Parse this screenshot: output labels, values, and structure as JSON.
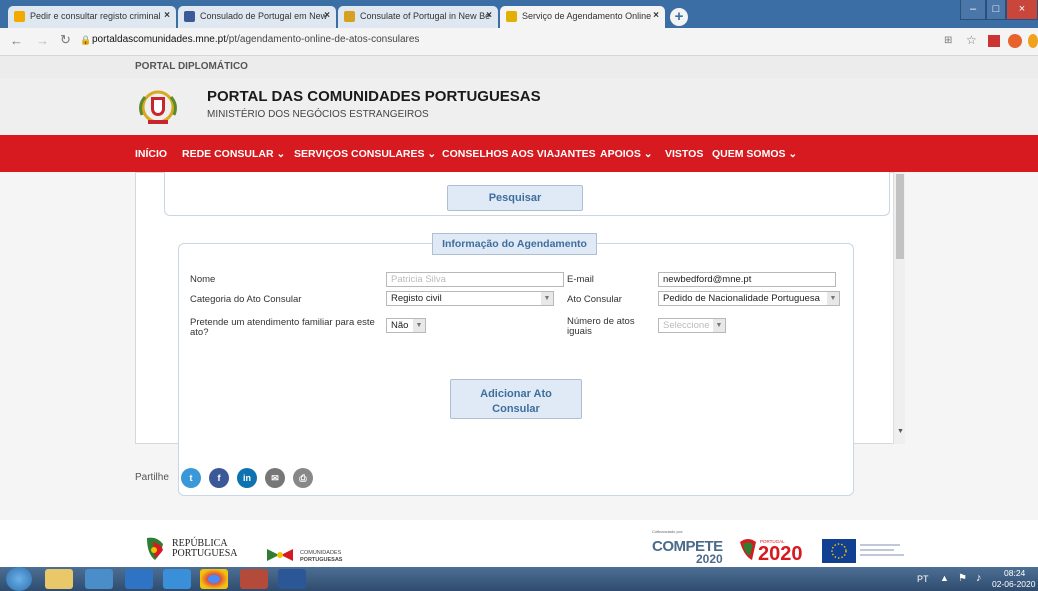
{
  "browser": {
    "tabs": [
      {
        "title": "Pedir e consultar registo criminal"
      },
      {
        "title": "Consulado de Portugal em New"
      },
      {
        "title": "Consulate of Portugal in New Be"
      },
      {
        "title": "Serviço de Agendamento Online"
      }
    ],
    "url_host": "portaldascomunidades.mne.pt",
    "url_path": "/pt/agendamento-online-de-atos-consulares"
  },
  "site": {
    "top_label": "PORTAL DIPLOMÁTICO",
    "title": "PORTAL DAS COMUNIDADES PORTUGUESAS",
    "subtitle": "MINISTÉRIO DOS NEGÓCIOS ESTRANGEIROS",
    "nav": [
      {
        "label": "INÍCIO"
      },
      {
        "label": "REDE CONSULAR ⌄"
      },
      {
        "label": "SERVIÇOS CONSULARES ⌄"
      },
      {
        "label": "CONSELHOS AOS VIAJANTES"
      },
      {
        "label": "APOIOS ⌄"
      },
      {
        "label": "VISTOS"
      },
      {
        "label": "QUEM SOMOS ⌄"
      }
    ]
  },
  "form": {
    "search_button": "Pesquisar",
    "section_title": "Informação do Agendamento",
    "nome_label": "Nome",
    "nome_placeholder": "Patricia Silva",
    "email_label": "E-mail",
    "email_value": "newbedford@mne.pt",
    "categoria_label": "Categoria do Ato Consular",
    "categoria_value": "Registo civil",
    "ato_label": "Ato Consular",
    "ato_value": "Pedido de Nacionalidade Portuguesa",
    "familiar_label_1": "Pretende um atendimento familiar para este",
    "familiar_label_2": "ato?",
    "familiar_value": "Não",
    "numero_label_1": "Número de atos",
    "numero_label_2": "iguais",
    "numero_value": "Seleccione",
    "add_button_1": "Adicionar Ato",
    "add_button_2": "Consular"
  },
  "share": {
    "label": "Partilhe",
    "icons": [
      "twitter-icon",
      "facebook-icon",
      "linkedin-icon",
      "email-icon",
      "print-icon"
    ]
  },
  "footer": {
    "republica_1": "REPÚBLICA",
    "republica_2": "PORTUGUESA",
    "comunidades_1": "COMUNIDADES",
    "comunidades_2": "PORTUGUESAS",
    "financiado": "Cofinanciado por:",
    "compete": "COMPETE",
    "compete_year": "2020",
    "portugal2020": "2020",
    "portugal_small": "PORTUGAL"
  },
  "taskbar": {
    "lang": "PT",
    "time": "08:24",
    "date": "02-06-2020"
  },
  "colors": {
    "nav_red": "#d71920",
    "accent_blue": "#3f6e9e"
  }
}
